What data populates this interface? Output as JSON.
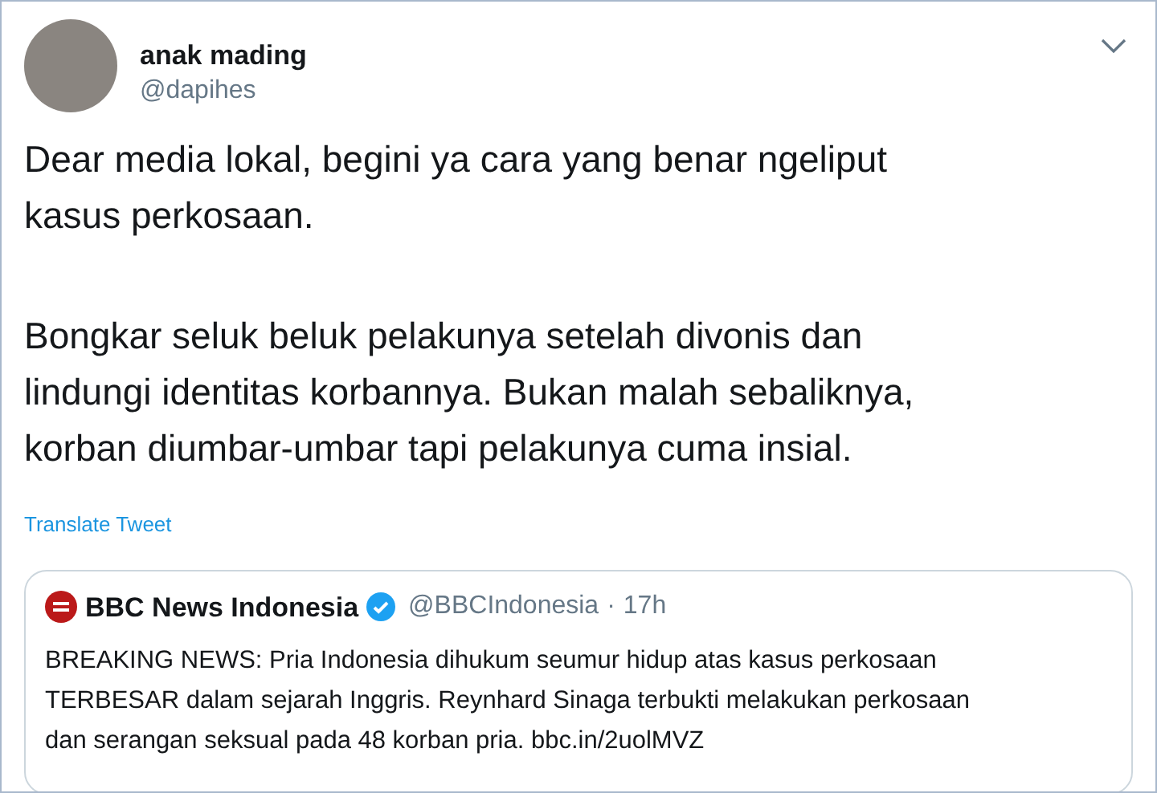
{
  "author": {
    "name": "anak mading",
    "handle": "@dapihes"
  },
  "paragraphs": [
    [
      "Dear media lokal, begini ya cara yang benar ngeliput",
      "kasus perkosaan."
    ],
    [
      "Bongkar seluk beluk pelakunya setelah divonis dan",
      "lindungi identitas korbannya. Bukan malah sebaliknya,",
      "korban diumbar-umbar tapi pelakunya cuma insial."
    ]
  ],
  "translate_link": "Translate Tweet",
  "quoted_tweet": {
    "name": "BBC News Indonesia",
    "verified": true,
    "handle": "@BBCIndonesia",
    "separator": "·",
    "time": "17h",
    "lines": [
      "BREAKING NEWS: Pria Indonesia dihukum seumur hidup atas kasus perkosaan",
      "TERBESAR dalam sejarah Inggris. Reynhard Sinaga terbukti melakukan perkosaan",
      "dan serangan seksual pada 48 korban pria. bbc.in/2uolMVZ"
    ]
  }
}
